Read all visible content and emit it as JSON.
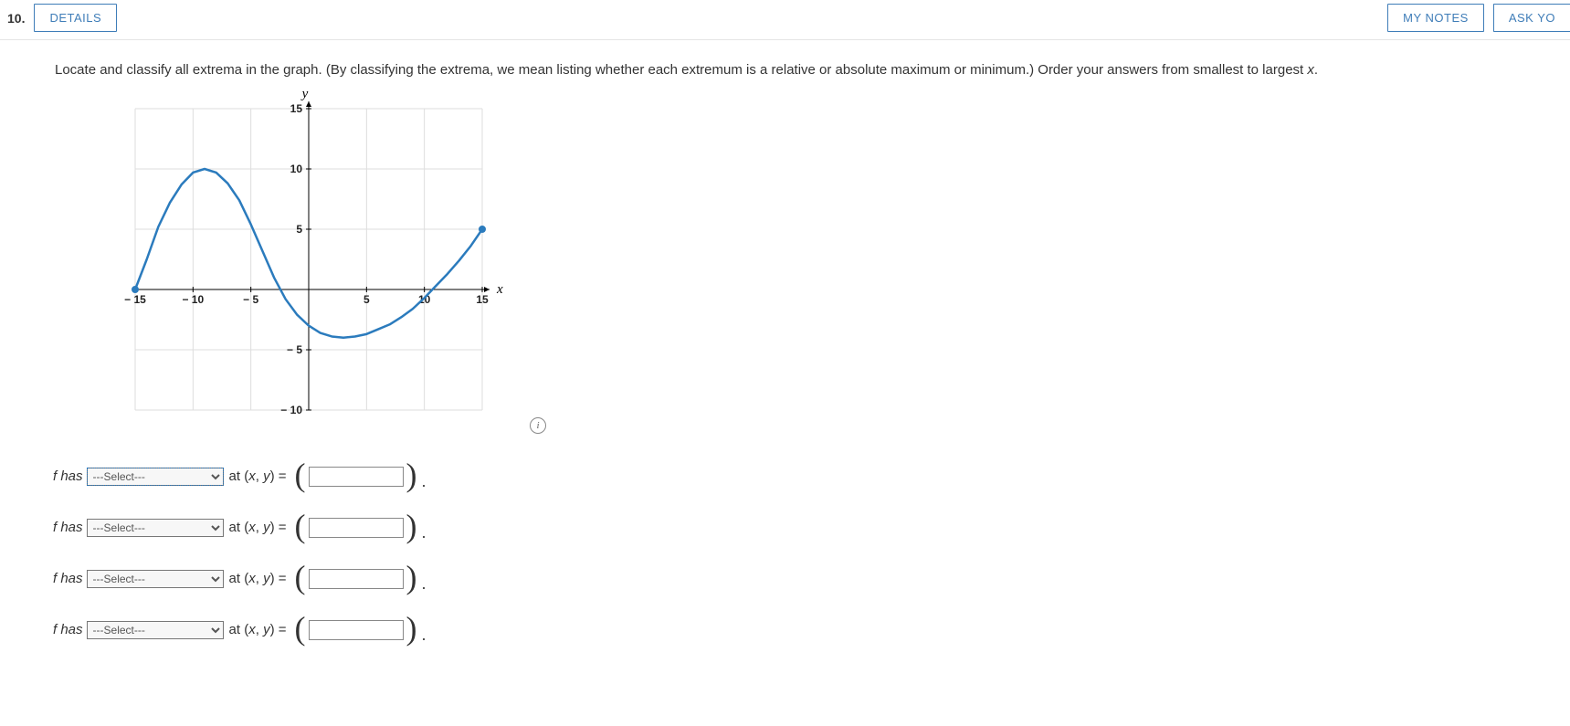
{
  "question_number": "10.",
  "buttons": {
    "details": "DETAILS",
    "my_notes": "MY NOTES",
    "ask": "ASK YO"
  },
  "prompt_pre": "Locate and classify all extrema in the graph. (By classifying the extrema, we mean listing whether each extremum is a relative or absolute maximum or minimum.) Order your answers from smallest to largest ",
  "prompt_var": "x",
  "prompt_post": ".",
  "chart_data": {
    "type": "line",
    "xlabel": "x",
    "ylabel": "y",
    "xlim": [
      -15,
      15
    ],
    "ylim": [
      -10,
      15
    ],
    "x_ticks": [
      -15,
      -10,
      -5,
      5,
      10,
      15
    ],
    "y_ticks": [
      -10,
      -5,
      5,
      10,
      15
    ],
    "endpoints": [
      {
        "x": -15,
        "y": 0,
        "kind": "closed"
      },
      {
        "x": 15,
        "y": 5,
        "kind": "closed"
      }
    ],
    "series": [
      {
        "name": "f",
        "points": [
          [
            -15,
            0
          ],
          [
            -14,
            2.5
          ],
          [
            -13,
            5.2
          ],
          [
            -12,
            7.2
          ],
          [
            -11,
            8.7
          ],
          [
            -10,
            9.7
          ],
          [
            -9,
            10
          ],
          [
            -8,
            9.7
          ],
          [
            -7,
            8.8
          ],
          [
            -6,
            7.4
          ],
          [
            -5,
            5.4
          ],
          [
            -4,
            3.2
          ],
          [
            -3,
            1.0
          ],
          [
            -2,
            -0.8
          ],
          [
            -1,
            -2.1
          ],
          [
            0,
            -3.0
          ],
          [
            1,
            -3.6
          ],
          [
            2,
            -3.9
          ],
          [
            3,
            -4.0
          ],
          [
            4,
            -3.9
          ],
          [
            5,
            -3.7
          ],
          [
            6,
            -3.3
          ],
          [
            7,
            -2.9
          ],
          [
            8,
            -2.3
          ],
          [
            9,
            -1.6
          ],
          [
            10,
            -0.7
          ],
          [
            11,
            0.3
          ],
          [
            12,
            1.3
          ],
          [
            13,
            2.4
          ],
          [
            14,
            3.6
          ],
          [
            15,
            5.0
          ]
        ]
      }
    ]
  },
  "rows": [
    {
      "prefix": "f has",
      "select_placeholder": "---Select---",
      "mid": "at (x, y) = ",
      "focused": true
    },
    {
      "prefix": "f has",
      "select_placeholder": "---Select---",
      "mid": "at (x, y) = ",
      "focused": false
    },
    {
      "prefix": "f has",
      "select_placeholder": "---Select---",
      "mid": "at (x, y) = ",
      "focused": false
    },
    {
      "prefix": "f has",
      "select_placeholder": "---Select---",
      "mid": "at (x, y) = ",
      "focused": false
    }
  ],
  "info_icon_glyph": "i"
}
